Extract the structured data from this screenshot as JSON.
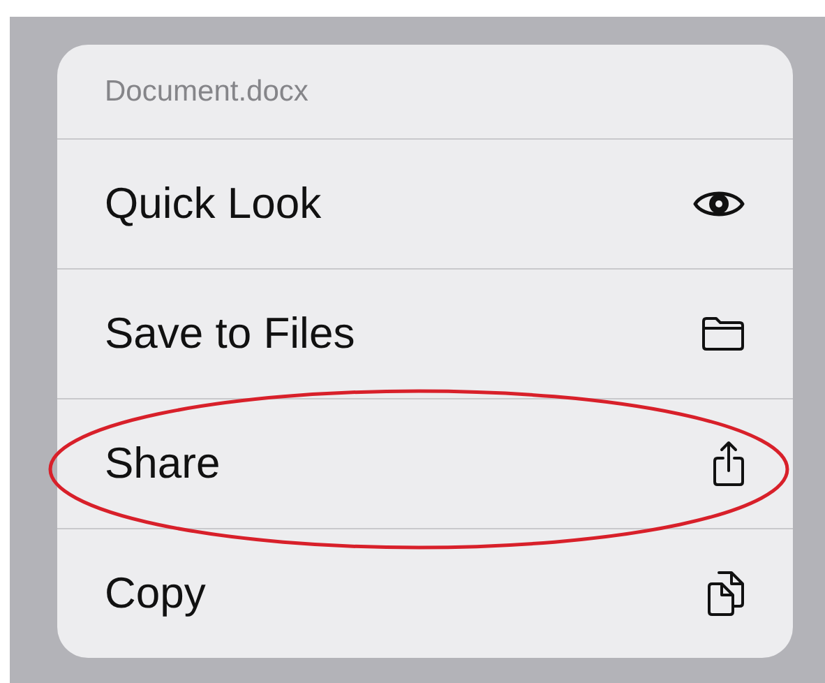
{
  "menu": {
    "title": "Document.docx",
    "items": [
      {
        "label": "Quick Look",
        "kind": "view",
        "circled": false
      },
      {
        "label": "Save to Files",
        "kind": "save",
        "circled": false
      },
      {
        "label": "Share",
        "kind": "share",
        "circled": true
      },
      {
        "label": "Copy",
        "kind": "copy",
        "circled": false
      }
    ]
  }
}
